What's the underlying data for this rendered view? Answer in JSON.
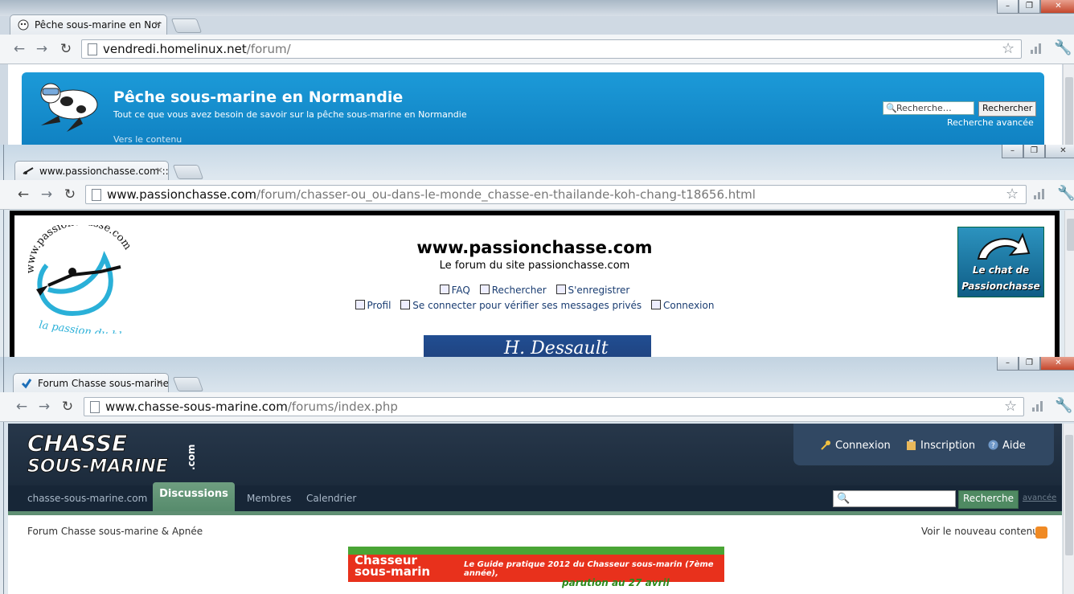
{
  "windows": [
    {
      "tab_title": "Pêche sous-marine en Nor",
      "url_host": "vendredi.homelinux.net",
      "url_path": "/forum/",
      "site_title": "Pêche sous-marine en Normandie",
      "site_description": "Tout ce que vous avez besoin de savoir sur la pêche sous-marine en Normandie",
      "skip_link": "Vers le contenu",
      "search_placeholder": "Recherche…",
      "search_button": "Rechercher",
      "advanced_search": "Recherche avancée"
    },
    {
      "tab_title": "www.passionchasse.com ::",
      "url_host": "www.passionchasse.com",
      "url_path": "/forum/chasser-ou_ou-dans-le-monde_chasse-en-thailande-koh-chang-t18656.html",
      "site_title": "www.passionchasse.com",
      "site_subtitle": "Le forum du site passionchasse.com",
      "links_row1": [
        "FAQ",
        "Rechercher",
        "S'enregistrer"
      ],
      "links_row2": [
        "Profil",
        "Se connecter pour vérifier ses messages privés",
        "Connexion"
      ],
      "logo_text_top": "www.passionchasse.com",
      "logo_text_bottom": "la passion du bleu",
      "chat_line1": "Le chat de",
      "chat_line2": "Passionchasse",
      "banner_text": "H. Dessault"
    },
    {
      "tab_title": "Forum Chasse sous-marine",
      "url_host": "www.chasse-sous-marine.com",
      "url_path": "/forums/index.php",
      "logo_line1": "CHASSE",
      "logo_line2": "SOUS-MARINE",
      "logo_com": ".com",
      "user_links": [
        "Connexion",
        "Inscription",
        "Aide"
      ],
      "home_link": "chasse-sous-marine.com",
      "nav_tabs": [
        "Discussions",
        "Membres",
        "Calendrier"
      ],
      "search_button": "Recherche",
      "advanced_link": "avancée",
      "breadcrumb": "Forum Chasse sous-marine & Apnée",
      "new_content": "Voir le nouveau contenu",
      "ad_brand_line1": "Chasseur",
      "ad_brand_line2": "sous-marin",
      "ad_headline": "Le Guide pratique 2012 du Chasseur sous-marin (7ème année),",
      "ad_date": "parution au 27 avril"
    }
  ],
  "colors": {
    "normandie_banner": "#1590d0",
    "passion_link": "#1a3d72",
    "csm_header": "#1c2b3c",
    "csm_accent": "#5f8f73"
  }
}
